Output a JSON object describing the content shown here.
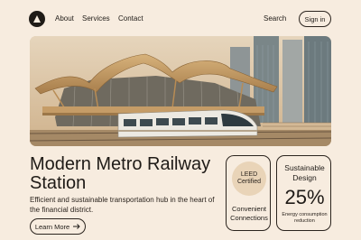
{
  "nav": {
    "links": [
      "About",
      "Services",
      "Contact"
    ],
    "search_label": "Search",
    "signin_label": "Sign in"
  },
  "hero": {
    "image_icon": "metro-station-illustration"
  },
  "main": {
    "headline_line1": "Modern Metro Railway",
    "headline_line2": "Station",
    "subtext": "Efficient and sustainable transportation hub in the heart of the financial district.",
    "cta_label": "Learn More"
  },
  "cards": {
    "leed": {
      "badge_line1": "LEED",
      "badge_line2": "Certified",
      "label_line1": "Convenient",
      "label_line2": "Connections"
    },
    "sustainable": {
      "title_line1": "Sustainable",
      "title_line2": "Design",
      "stat": "25%",
      "caption_line1": "Energy consumption",
      "caption_line2": "reduction"
    }
  },
  "colors": {
    "background": "#f7ecdf",
    "text": "#1f1b17",
    "badge": "#e9d4b8",
    "train": "#ece9e2"
  }
}
